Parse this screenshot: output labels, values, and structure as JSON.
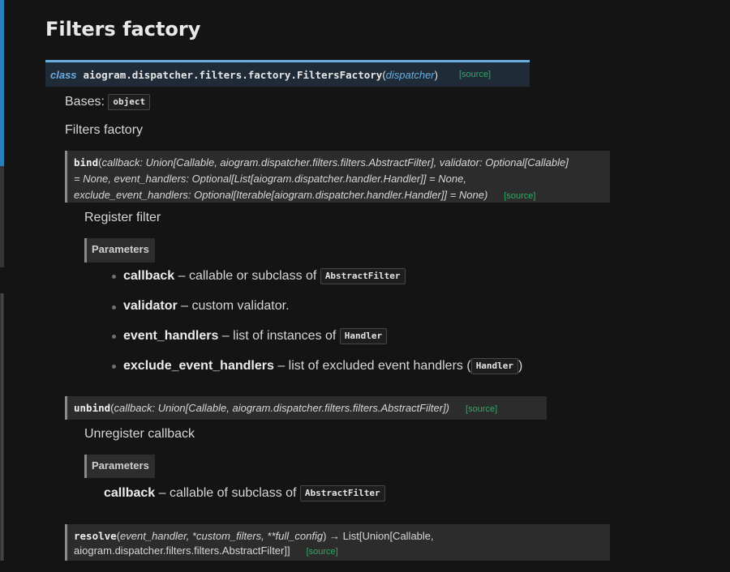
{
  "page_title": "Filters factory",
  "class_sig": {
    "keyword": "class",
    "name": "aiogram.dispatcher.filters.factory.FiltersFactory",
    "open": "(",
    "param": "dispatcher",
    "close": ")",
    "source": "[source]"
  },
  "bases": {
    "label": "Bases:",
    "value": "object"
  },
  "class_desc": "Filters factory",
  "bind": {
    "name": "bind",
    "line1": "callback: Union[Callable, aiogram.dispatcher.filters.filters.AbstractFilter], validator: Optional[Callable]",
    "line2": "= None, event_handlers: Optional[List[aiogram.dispatcher.handler.Handler]] = None,",
    "line3": "exclude_event_handlers: Optional[Iterable[aiogram.dispatcher.handler.Handler]] = None)",
    "source": "[source]",
    "description": "Register filter",
    "params_label": "Parameters",
    "params": [
      {
        "name": "callback",
        "desc": " – callable or subclass of ",
        "code": "AbstractFilter",
        "tail": ""
      },
      {
        "name": "validator",
        "desc": " – custom validator.",
        "code": "",
        "tail": ""
      },
      {
        "name": "event_handlers",
        "desc": " – list of instances of ",
        "code": "Handler",
        "tail": ""
      },
      {
        "name": "exclude_event_handlers",
        "desc": " – list of excluded event handlers (",
        "code": "Handler",
        "tail": ")"
      }
    ]
  },
  "unbind": {
    "name": "unbind",
    "args": "callback: Union[Callable, aiogram.dispatcher.filters.filters.AbstractFilter])",
    "source": "[source]",
    "description": "Unregister callback",
    "params_label": "Parameters",
    "param_name": "callback",
    "param_desc": " – callable of subclass of ",
    "param_code": "AbstractFilter"
  },
  "resolve": {
    "name": "resolve",
    "line1_args": "event_handler, *custom_filters, **full_config",
    "line1_ret": ") → List[Union[Callable,",
    "line2": "aiogram.dispatcher.filters.filters.AbstractFilter]]",
    "source": "[source]"
  }
}
